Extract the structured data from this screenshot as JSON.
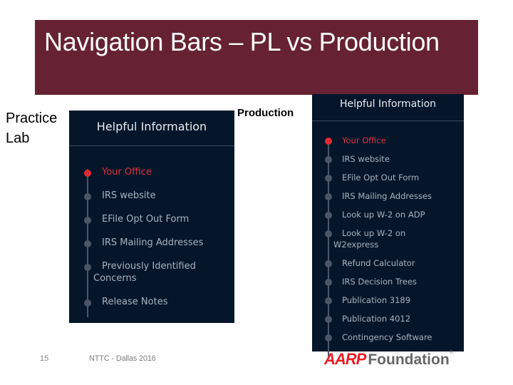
{
  "slide": {
    "title": "Navigation Bars – PL vs Production",
    "title_bg_color": "#662232",
    "page_number": "15",
    "footer_text": "NTTC - Dallas 2016"
  },
  "labels": {
    "practice_lab": "Practice Lab",
    "production": "Production"
  },
  "practice_lab_panel": {
    "header": "Helpful Information",
    "items": [
      {
        "label": "Your Office",
        "active": true
      },
      {
        "label": "IRS website"
      },
      {
        "label": "EFile Opt Out Form"
      },
      {
        "label": "IRS Mailing Addresses"
      },
      {
        "label": "Previously Identified",
        "label_line2": "Concerns"
      },
      {
        "label": "Release Notes"
      }
    ]
  },
  "production_panel": {
    "header": "Helpful Information",
    "items": [
      {
        "label": "Your Office",
        "active": true
      },
      {
        "label": "IRS website"
      },
      {
        "label": "EFile Opt Out Form"
      },
      {
        "label": "IRS Mailing Addresses"
      },
      {
        "label": "Look up W-2 on ADP"
      },
      {
        "label": "Look up W-2 on",
        "label_line2": "W2express"
      },
      {
        "label": "Refund Calculator"
      },
      {
        "label": "IRS Decision Trees"
      },
      {
        "label": "Publication 3189"
      },
      {
        "label": "Publication 4012"
      },
      {
        "label": "Contingency Software"
      }
    ]
  },
  "colors": {
    "panel_bg": "#06162a",
    "active_item": "#d9343f",
    "inactive_item": "#a8b2bf",
    "brand_red": "#ec1c24"
  },
  "logo": {
    "brand": "AARP",
    "suffix": "Foundation",
    "mark": "®"
  }
}
